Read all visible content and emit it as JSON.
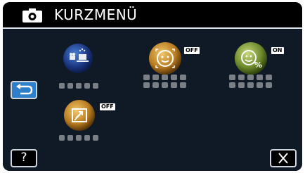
{
  "header": {
    "title": "KURZMENÜ",
    "icon": "camera-icon"
  },
  "menu_items": [
    {
      "icon": "video-to-computer-icon",
      "status": ""
    },
    {
      "icon": "face-detect-icon",
      "status": "OFF"
    },
    {
      "icon": "smile-percent-icon",
      "status": "ON"
    },
    {
      "icon": "touch-priority-icon",
      "status": "OFF"
    }
  ],
  "buttons": {
    "return_icon": "return-arrow-icon",
    "help_label": "?",
    "close_icon": "close-icon"
  },
  "colors": {
    "screen": "#000000",
    "panel": "#0f1a26",
    "accent": "#2f7ec9"
  }
}
